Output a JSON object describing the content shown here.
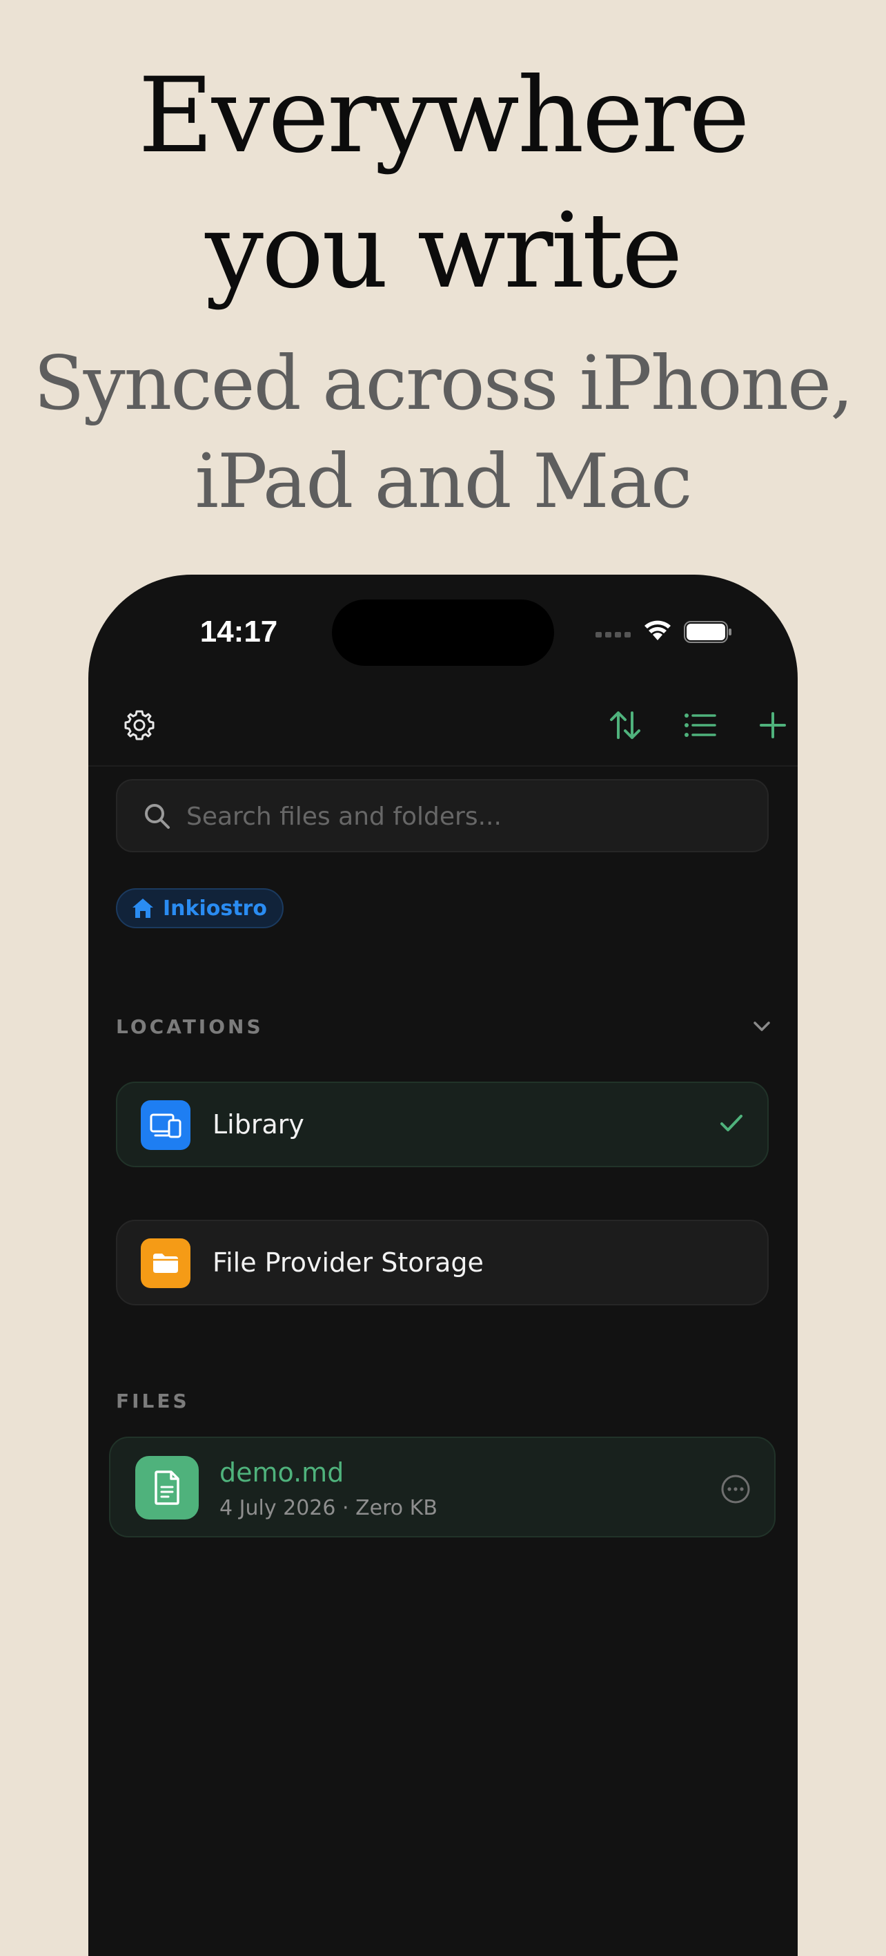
{
  "marketing": {
    "headline_line1": "Everywhere",
    "headline_line2": "you write",
    "subheadline_line1": "Synced across iPhone,",
    "subheadline_line2": "iPad and Mac"
  },
  "status_bar": {
    "time": "14:17",
    "icons": [
      "cellular-icon",
      "wifi-icon",
      "battery-icon"
    ]
  },
  "toolbar": {
    "left_icon": "gear-icon",
    "right_icons": [
      "sort-icon",
      "list-icon",
      "plus-icon"
    ]
  },
  "search": {
    "placeholder": "Search files and folders...",
    "value": ""
  },
  "breadcrumb": {
    "icon": "home-icon",
    "label": "Inkiostro"
  },
  "locations": {
    "header": "LOCATIONS",
    "items": [
      {
        "label": "Library",
        "icon": "devices-icon",
        "icon_color": "#1e7ef2",
        "selected": true
      },
      {
        "label": "File Provider Storage",
        "icon": "folder-icon",
        "icon_color": "#f59b16",
        "selected": false
      }
    ]
  },
  "files": {
    "header": "FILES",
    "items": [
      {
        "name": "demo.md",
        "meta": "4 July 2026 · Zero KB",
        "icon": "document-icon"
      }
    ]
  },
  "colors": {
    "accent": "#4fb27c",
    "background": "#ebe2d4",
    "app_bg": "#121212",
    "link": "#2a8cf2"
  }
}
